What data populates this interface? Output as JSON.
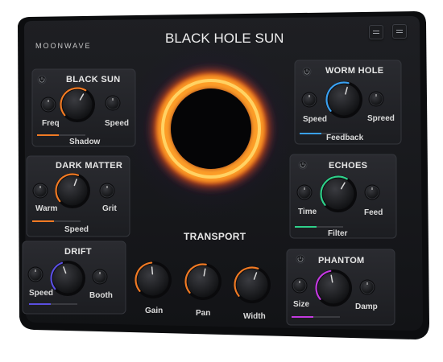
{
  "header": {
    "brand": "MOONWAVE",
    "title": "BLACK HOLE SUN",
    "buttons": [
      "menu-a",
      "menu-b"
    ]
  },
  "panels": {
    "black_sun": {
      "title": "BLACK SUN",
      "knobs": [
        "Freq",
        "Speed"
      ],
      "footer": "Shadow",
      "accent": "#f07a24"
    },
    "dark_matter": {
      "title": "DARK MATTER",
      "knobs": [
        "Warm",
        "Grit"
      ],
      "footer": "Speed",
      "accent": "#f07a24"
    },
    "drift": {
      "title": "DRIFT",
      "knobs": [
        "Speed",
        "Booth"
      ],
      "accent": "#5a4fe0"
    },
    "worm_hole": {
      "title": "WORM HOLE",
      "knobs": [
        "Speed",
        "Spreed"
      ],
      "footer": "Feedback",
      "accent": "#3aa0f0"
    },
    "echoes": {
      "title": "ECHOES",
      "knobs": [
        "Time",
        "Feed"
      ],
      "footer": "Filter",
      "accent": "#2fd08a"
    },
    "phantom": {
      "title": "PHANTOM",
      "knobs": [
        "Size",
        "Damp"
      ],
      "accent": "#c23adf"
    }
  },
  "transport": {
    "title": "TRANSPORT",
    "knobs": [
      "Gain",
      "Pan",
      "Width"
    ],
    "accent": "#f07a24"
  },
  "colors": {
    "shell": "#17181b",
    "panel": "#222327",
    "fire_outer": "#ff5a10",
    "fire_inner": "#ffd050"
  }
}
